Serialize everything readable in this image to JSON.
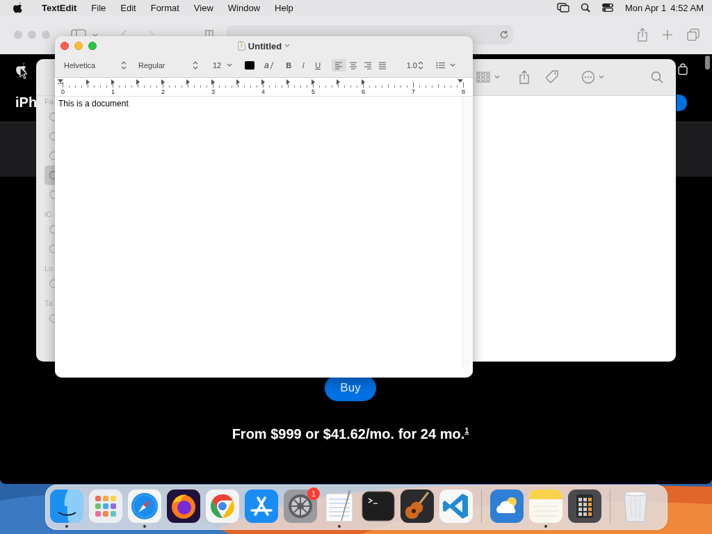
{
  "menu_bar": {
    "app": "TextEdit",
    "menus": [
      "File",
      "Edit",
      "Format",
      "View",
      "Window",
      "Help"
    ],
    "date": "Mon Apr 1",
    "time": "4:52 AM"
  },
  "safari": {
    "page": {
      "heading": "iPh",
      "buy_button": "Buy",
      "price": "From $999 or $41.62/mo. for 24 mo.$^{1}$"
    }
  },
  "finder": {
    "sidebar": [
      {
        "heading": "Fa",
        "items": [
          {
            "selected": false
          },
          {
            "selected": false
          },
          {
            "selected": false
          },
          {
            "selected": true
          },
          {
            "selected": false
          }
        ]
      },
      {
        "heading": "iC",
        "items": [
          {
            "selected": false
          },
          {
            "selected": false
          }
        ]
      },
      {
        "heading": "Lo",
        "items": [
          {
            "selected": false
          }
        ]
      },
      {
        "heading": "Ta",
        "items": [
          {
            "selected": false
          }
        ]
      }
    ]
  },
  "textedit": {
    "title": "Untitled",
    "font_family": "Helvetica",
    "font_style": "Regular",
    "font_size": "12",
    "highlight": "a",
    "format_buttons": [
      {
        "kind": "bold",
        "label": "B"
      },
      {
        "kind": "italic",
        "label": "I"
      },
      {
        "kind": "underline",
        "label": "U"
      }
    ],
    "alignments": [
      {
        "kind": "left",
        "selected": true
      },
      {
        "kind": "center",
        "selected": false
      },
      {
        "kind": "right",
        "selected": false
      },
      {
        "kind": "justify",
        "selected": false
      }
    ],
    "line_spacing": "1.0",
    "ruler": [
      "0",
      "1",
      "2",
      "3",
      "4",
      "5",
      "6",
      "7",
      "8"
    ],
    "text": "This is a document"
  },
  "dock": {
    "sections": [
      {
        "items": [
          {
            "kind": "finder",
            "running": true
          },
          {
            "kind": "launchpad",
            "running": false
          },
          {
            "kind": "safari",
            "running": true
          },
          {
            "kind": "firefox",
            "running": false
          },
          {
            "kind": "chrome",
            "running": false
          },
          {
            "kind": "appstore",
            "running": false
          },
          {
            "kind": "settings",
            "running": false,
            "badge": "1"
          },
          {
            "kind": "textedit",
            "running": true
          },
          {
            "kind": "terminal",
            "running": false
          },
          {
            "kind": "garageband",
            "running": false
          },
          {
            "kind": "vscode",
            "running": false
          }
        ]
      },
      {
        "items": [
          {
            "kind": "weather",
            "running": false
          },
          {
            "kind": "notes",
            "running": true
          },
          {
            "kind": "calculator",
            "running": false
          }
        ]
      },
      {
        "items": [
          {
            "kind": "trash",
            "running": false
          }
        ]
      }
    ]
  }
}
